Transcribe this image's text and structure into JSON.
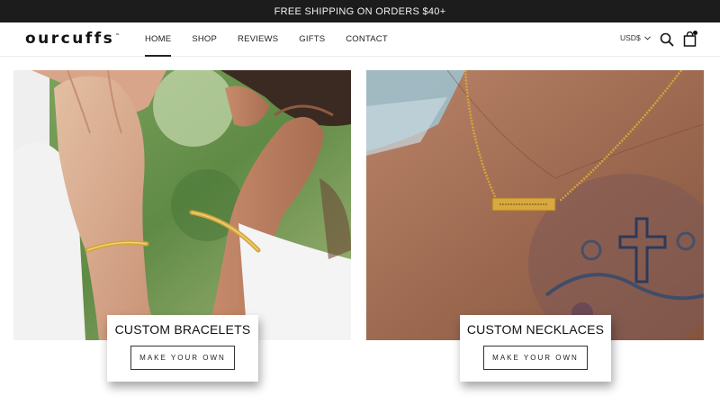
{
  "announcement": {
    "text": "FREE SHIPPING ON ORDERS $40+"
  },
  "header": {
    "logo": "ourcuffs",
    "logo_tm": "™",
    "nav": [
      {
        "label": "HOME",
        "active": true
      },
      {
        "label": "SHOP"
      },
      {
        "label": "REVIEWS"
      },
      {
        "label": "GIFTS"
      },
      {
        "label": "CONTACT"
      }
    ],
    "currency": "USD$",
    "icons": {
      "search": "search-icon",
      "cart": "cart-icon",
      "currency": "chevron-down-icon"
    }
  },
  "cards": [
    {
      "title": "CUSTOM BRACELETS",
      "cta": "MAKE YOUR OWN",
      "image": "couple-wearing-gold-bracelets-photo"
    },
    {
      "title": "CUSTOM NECKLACES",
      "cta": "MAKE YOUR OWN",
      "image": "man-wearing-gold-bar-necklace-photo"
    }
  ],
  "colors": {
    "announcement_bg": "#1c1c1c",
    "gold": "#d4a63a",
    "text": "#1c1b1b"
  }
}
